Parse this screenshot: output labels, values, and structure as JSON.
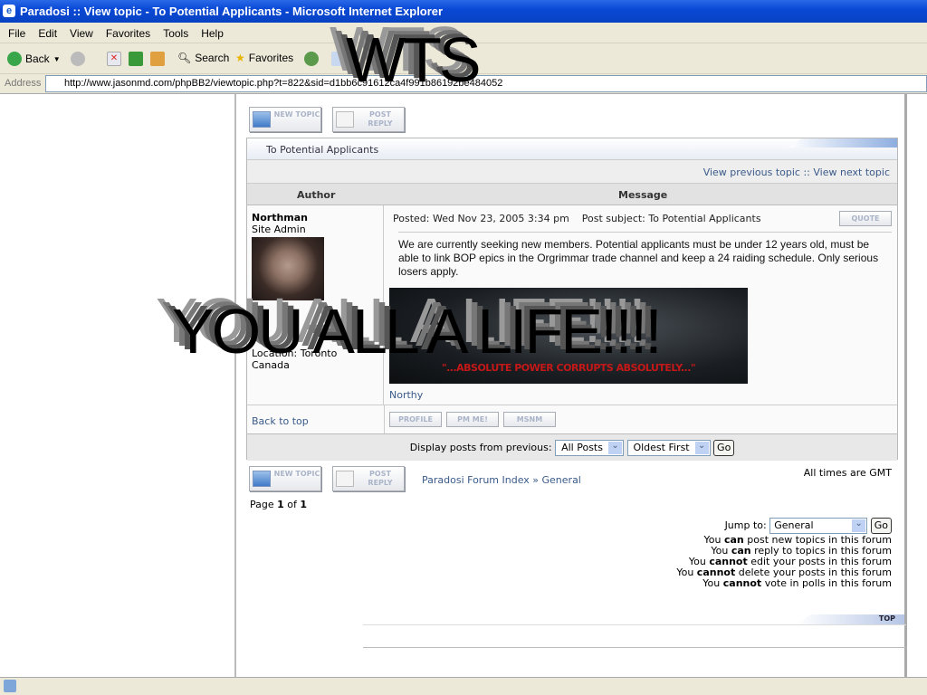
{
  "window": {
    "title": "Paradosi :: View topic - To Potential Applicants - Microsoft Internet Explorer"
  },
  "menu": [
    "File",
    "Edit",
    "View",
    "Favorites",
    "Tools",
    "Help"
  ],
  "toolbar": {
    "back": "Back",
    "search": "Search",
    "favorites": "Favorites"
  },
  "address": {
    "label": "Address",
    "url": "http://www.jasonmd.com/phpBB2/viewtopic.php?t=822&sid=d1bb6c91612ca4f991b86192be484052"
  },
  "buttons": {
    "new_topic": "NEW TOPIC",
    "post_reply": "POST REPLY",
    "quote": "QUOTE",
    "profile": "PROFILE",
    "pm": "PM ME!",
    "msnm": "MSNM",
    "go": "Go"
  },
  "topic": {
    "title": "To Potential Applicants",
    "prev": "View previous topic",
    "sep": "::",
    "next": "View next topic"
  },
  "headers": {
    "author": "Author",
    "message": "Message"
  },
  "post": {
    "author": "Northman",
    "rank": "Site Admin",
    "loc1": "Location: Toronto",
    "loc2": "Canada",
    "posted": "Posted: Wed Nov 23, 2005 3:34 pm",
    "subject": "Post subject: To Potential Applicants",
    "body": "We are currently seeking new members. Potential applicants must be under 12 years old, must be able to link BOP epics in the Orgrimmar trade channel and keep a 24 raiding schedule. Only serious losers apply.",
    "signature_banner": "\"...ABSOLUTE POWER CORRUPTS ABSOLUTELY...\"",
    "signature": "Northy"
  },
  "back_to_top": "Back to top",
  "display": {
    "label": "Display posts from previous:",
    "range": "All Posts",
    "order": "Oldest First"
  },
  "breadcrumb": "Paradosi Forum Index » General",
  "timezone": "All times are GMT",
  "pagination": {
    "prefix": "Page",
    "current": "1",
    "of": "of",
    "total": "1"
  },
  "jump": {
    "label": "Jump to:",
    "value": "General"
  },
  "permissions": [
    {
      "pre": "You",
      "verb": "can",
      "post": "post new topics in this forum"
    },
    {
      "pre": "You",
      "verb": "can",
      "post": "reply to topics in this forum"
    },
    {
      "pre": "You",
      "verb": "cannot",
      "post": "edit your posts in this forum"
    },
    {
      "pre": "You",
      "verb": "cannot",
      "post": "delete your posts in this forum"
    },
    {
      "pre": "You",
      "verb": "cannot",
      "post": "vote in polls in this forum"
    }
  ],
  "top_label": "TOP",
  "overlay": {
    "top": "WTS",
    "middle": "YOU ALL A LIFE!!!!"
  }
}
